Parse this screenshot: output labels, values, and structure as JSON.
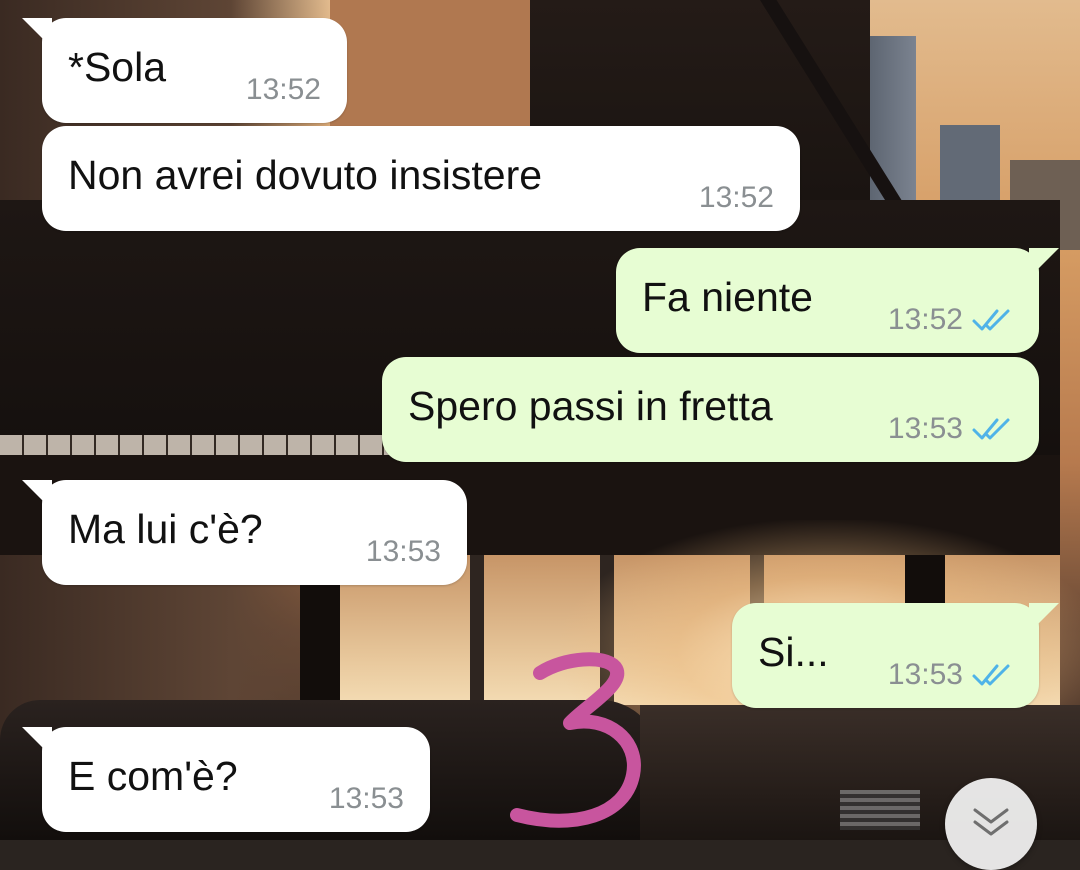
{
  "messages": [
    {
      "direction": "incoming",
      "text": "*Sola",
      "time": "13:52"
    },
    {
      "direction": "incoming",
      "text": "Non avrei dovuto insistere",
      "time": "13:52"
    },
    {
      "direction": "outgoing",
      "text": "Fa niente",
      "time": "13:52",
      "status": "read"
    },
    {
      "direction": "outgoing",
      "text": "Spero passi in fretta",
      "time": "13:53",
      "status": "read"
    },
    {
      "direction": "incoming",
      "text": "Ma lui c'è?",
      "time": "13:53"
    },
    {
      "direction": "outgoing",
      "text": "Si...",
      "time": "13:53",
      "status": "read"
    },
    {
      "direction": "incoming",
      "text": "E com'è?",
      "time": "13:53"
    }
  ],
  "annotation": {
    "text": "3",
    "color": "#c8559e"
  },
  "colors": {
    "incoming_bubble": "#ffffff",
    "outgoing_bubble": "#e7fdd3",
    "read_ticks": "#4fb3e8",
    "timestamp": "#8a8f92"
  },
  "icons": {
    "read_status": "double-check-icon",
    "scroll_down": "chevrons-down-icon"
  }
}
